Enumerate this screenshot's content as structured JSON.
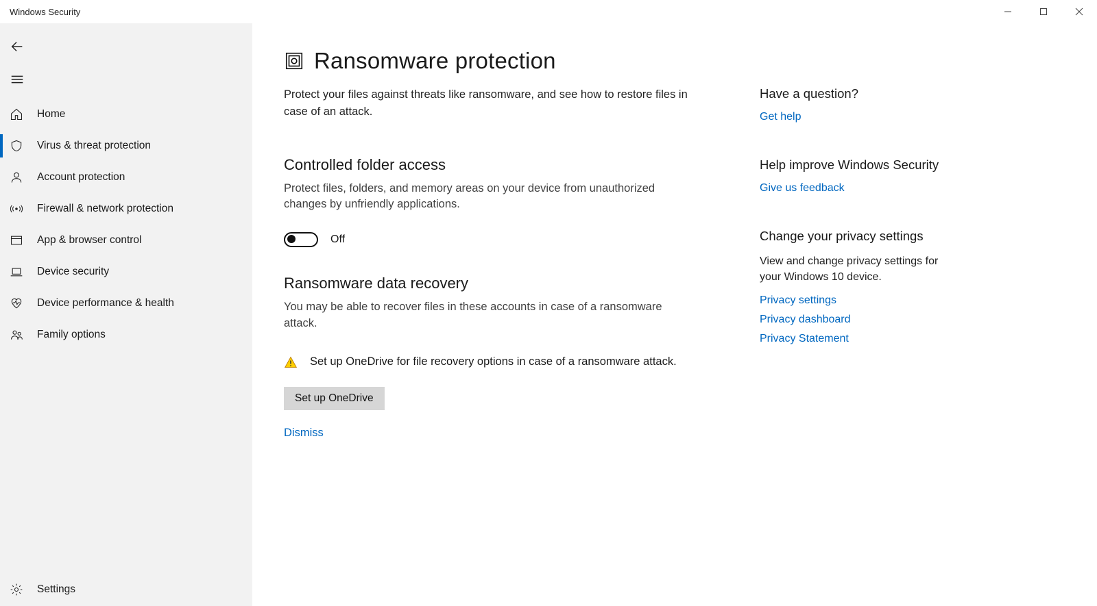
{
  "window": {
    "title": "Windows Security"
  },
  "sidebar": {
    "items": [
      {
        "label": "Home"
      },
      {
        "label": "Virus & threat protection"
      },
      {
        "label": "Account protection"
      },
      {
        "label": "Firewall & network protection"
      },
      {
        "label": "App & browser control"
      },
      {
        "label": "Device security"
      },
      {
        "label": "Device performance & health"
      },
      {
        "label": "Family options"
      }
    ],
    "settings_label": "Settings"
  },
  "page": {
    "title": "Ransomware protection",
    "description": "Protect your files against threats like ransomware, and see how to restore files in case of an attack."
  },
  "controlled": {
    "heading": "Controlled folder access",
    "description": "Protect files, folders, and memory areas on your device from unauthorized changes by unfriendly applications.",
    "toggle_state": "Off"
  },
  "recovery": {
    "heading": "Ransomware data recovery",
    "description": "You may be able to recover files in these accounts in case of a ransomware attack.",
    "warning": "Set up OneDrive for file recovery options in case of a ransomware attack.",
    "button": "Set up OneDrive",
    "dismiss": "Dismiss"
  },
  "aside": {
    "question_heading": "Have a question?",
    "get_help": "Get help",
    "improve_heading": "Help improve Windows Security",
    "feedback": "Give us feedback",
    "privacy_heading": "Change your privacy settings",
    "privacy_text": "View and change privacy settings for your Windows 10 device.",
    "links": {
      "settings": "Privacy settings",
      "dashboard": "Privacy dashboard",
      "statement": "Privacy Statement"
    }
  }
}
